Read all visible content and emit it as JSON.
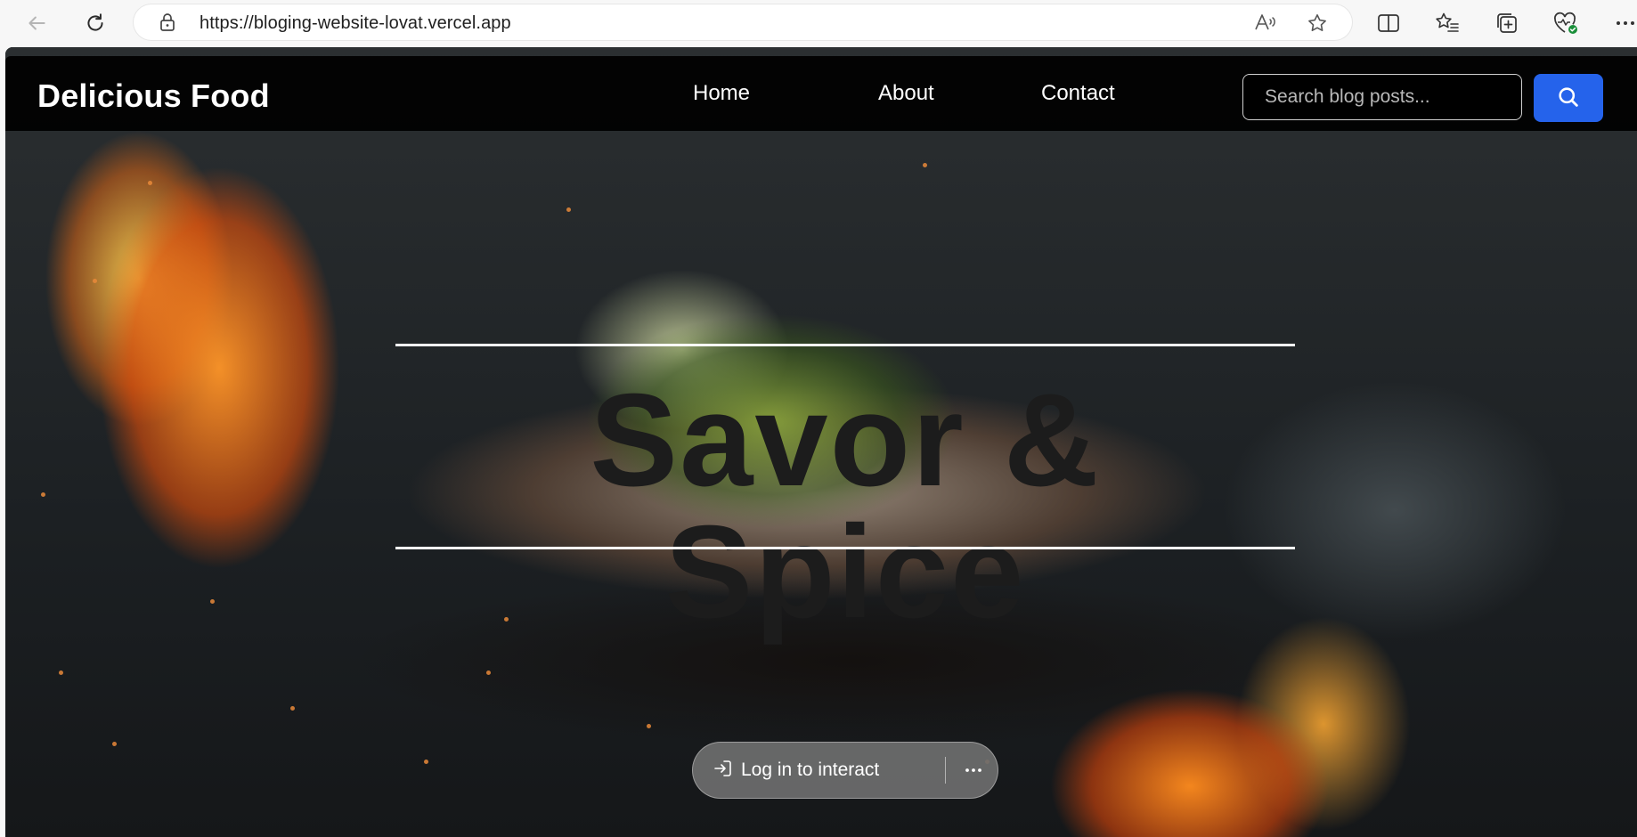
{
  "browser": {
    "url": "https://bloging-website-lovat.vercel.app",
    "icons": [
      "back-icon",
      "refresh-icon",
      "lock-icon",
      "read-aloud-icon",
      "favorite-star-icon",
      "split-screen-icon",
      "favorites-icon",
      "collections-icon",
      "browser-essentials-icon"
    ]
  },
  "navbar": {
    "brand": "Delicious Food",
    "links": [
      "Home",
      "About",
      "Contact"
    ],
    "search_placeholder": "Search blog posts...",
    "search_button_icon": "search-icon",
    "accent_color": "#2563eb"
  },
  "hero": {
    "title": "Savor & Spice"
  },
  "overlay": {
    "login_label": "Log in to interact",
    "more_icon": "more-options-icon"
  }
}
